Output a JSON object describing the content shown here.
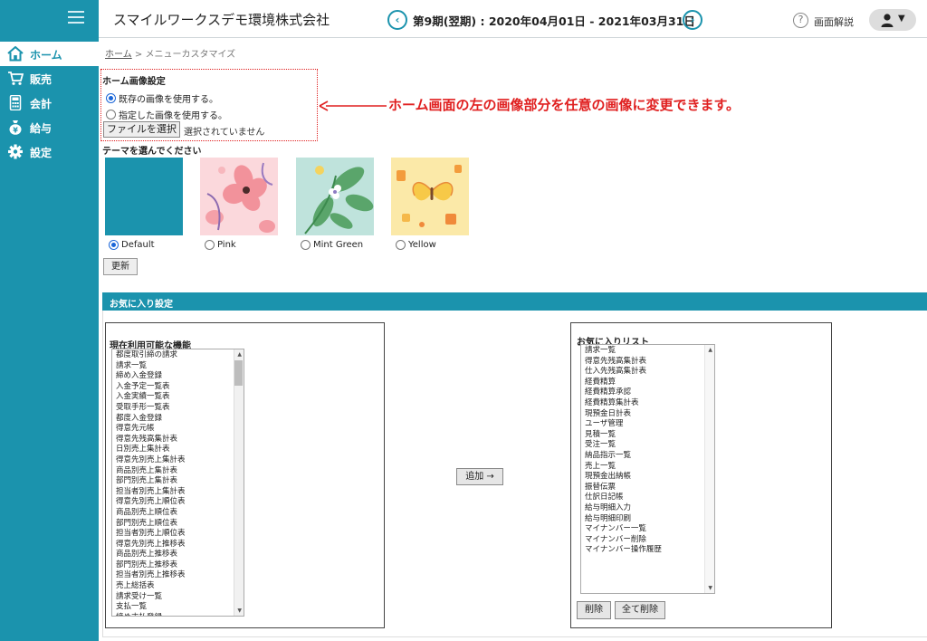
{
  "header": {
    "company": "スマイルワークスデモ環境株式会社",
    "period": "第9期(翌期) : 2020年04月01日 - 2021年03月31日",
    "prev_icon": "‹",
    "next_icon": "›",
    "help_icon": "?",
    "help_label": "画面解説",
    "user_caret": "▼"
  },
  "sidebar": {
    "items": [
      {
        "label": "ホーム",
        "icon": "home-icon"
      },
      {
        "label": "販売",
        "icon": "cart-icon"
      },
      {
        "label": "会計",
        "icon": "calculator-icon"
      },
      {
        "label": "給与",
        "icon": "money-bag-icon"
      },
      {
        "label": "設定",
        "icon": "gear-icon"
      }
    ]
  },
  "breadcrumb": {
    "home": "ホーム",
    "separator": ">",
    "current": "メニューカスタマイズ"
  },
  "image_setting": {
    "title": "ホーム画像設定",
    "option_existing": "既存の画像を使用する。",
    "option_custom": "指定した画像を使用する。",
    "selected": "existing",
    "file_button": "ファイルを選択",
    "file_status": "選択されていません"
  },
  "annotation": {
    "text": "ホーム画面の左の画像部分を任意の画像に変更できます。",
    "color": "#e02020"
  },
  "theme": {
    "title": "テーマを選んでください",
    "options": [
      {
        "label": "Default",
        "selected": true
      },
      {
        "label": "Pink",
        "selected": false
      },
      {
        "label": "Mint Green",
        "selected": false
      },
      {
        "label": "Yellow",
        "selected": false
      }
    ],
    "update_button": "更新"
  },
  "favorites": {
    "section_title": "お気に入り設定",
    "available_title": "現在利用可能な機能",
    "available_items": [
      "都度取引締の請求",
      "請求一覧",
      "締め入金登録",
      "入金予定一覧表",
      "入金実績一覧表",
      "受取手形一覧表",
      "都度入金登録",
      "得意先元帳",
      "得意先残高集計表",
      "日別売上集計表",
      "得意先別売上集計表",
      "商品別売上集計表",
      "部門別売上集計表",
      "担当者別売上集計表",
      "得意先別売上順位表",
      "商品別売上順位表",
      "部門別売上順位表",
      "担当者別売上順位表",
      "得意先別売上推移表",
      "商品別売上推移表",
      "部門別売上推移表",
      "担当者別売上推移表",
      "売上総括表",
      "請求受け一覧",
      "支払一覧",
      "締め支払登録"
    ],
    "add_button": "追加 →",
    "fav_title": "お気に入りリスト",
    "fav_items": [
      "請求一覧",
      "得意先残高集計表",
      "仕入先残高集計表",
      "経費精算",
      "経費精算承認",
      "経費精算集計表",
      "現預金日計表",
      "ユーザ管理",
      "見積一覧",
      "受注一覧",
      "納品指示一覧",
      "売上一覧",
      "現預金出納帳",
      "振替伝票",
      "仕訳日記帳",
      "給与明細入力",
      "給与明細印刷",
      "マイナンバー一覧",
      "マイナンバー削除",
      "マイナンバー操作履歴"
    ],
    "delete_button": "削除",
    "delete_all_button": "全て削除"
  },
  "colors": {
    "brand": "#1b93ad",
    "annotation": "#e02020"
  }
}
